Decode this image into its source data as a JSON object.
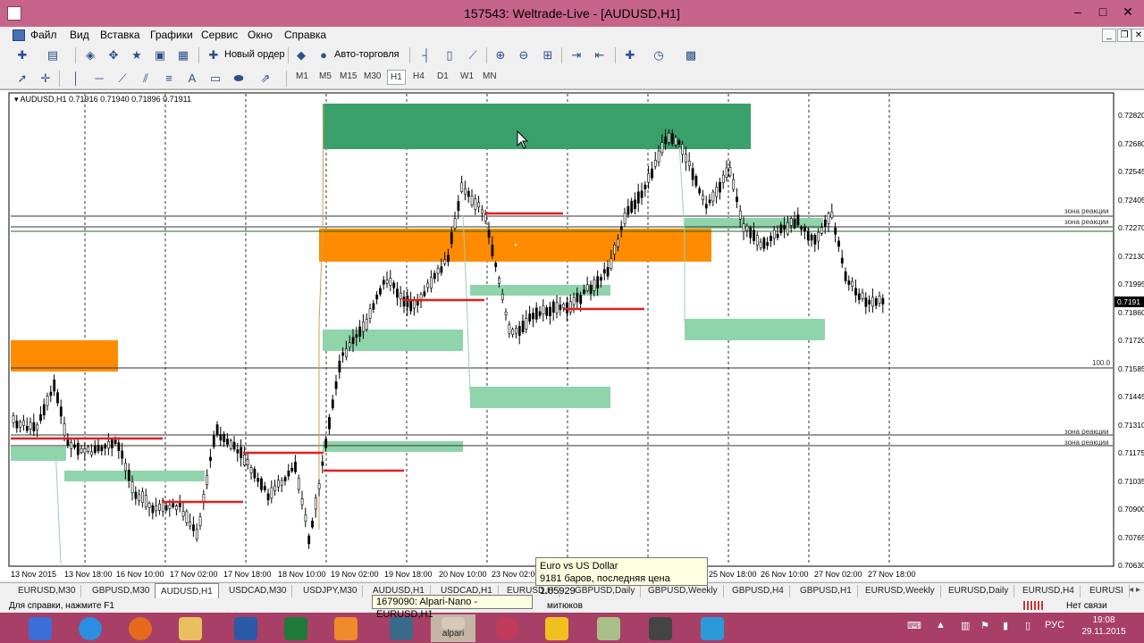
{
  "window": {
    "title": "157543: Weltrade-Live - [AUDUSD,H1]",
    "minimize": "–",
    "maximize": "□",
    "close": "✕"
  },
  "menu": {
    "items": [
      "Файл",
      "Вид",
      "Вставка",
      "Графики",
      "Сервис",
      "Окно",
      "Справка"
    ],
    "mdi_minimize": "_",
    "mdi_restore": "❐",
    "mdi_close": "✕"
  },
  "toolbar": {
    "new_order": "Новый ордер",
    "auto_trading": "Авто-торговля",
    "timeframes": [
      "M1",
      "M5",
      "M15",
      "M30",
      "H1",
      "H4",
      "D1",
      "W1",
      "MN"
    ],
    "active_timeframe": "H1",
    "search_placeholder": ""
  },
  "chart": {
    "header": "AUDUSD,H1  0.71916 0.71940 0.71896 0.71911",
    "symbol": "AUDUSD",
    "timeframe": "H1",
    "ohlc": {
      "open": 0.71916,
      "high": 0.7194,
      "low": 0.71896,
      "close": 0.71911
    },
    "current_price": "0.7191",
    "price_labels": [
      "0.72820",
      "0.72680",
      "0.72545",
      "0.72405",
      "0.72270",
      "0.72130",
      "0.71995",
      "0.71860",
      "0.71720",
      "0.71585",
      "0.71445",
      "0.71310",
      "0.71175",
      "0.71035",
      "0.70900",
      "0.70765",
      "0.70630"
    ],
    "time_labels": [
      "13 Nov 2015",
      "13 Nov 18:00",
      "16 Nov 10:00",
      "17 Nov 02:00",
      "17 Nov 18:00",
      "18 Nov 10:00",
      "19 Nov 02:00",
      "19 Nov 18:00",
      "20 Nov 10:00",
      "23 Nov 02:00",
      "25 Nov 18:00",
      "26 Nov 10:00",
      "27 Nov 02:00",
      "27 Nov 18:00"
    ],
    "zone_label": "зона реакции",
    "level_label": "100.0",
    "colors": {
      "bull_zone_dark": "#3aa06a",
      "bull_zone_light": "#8fd4aa",
      "orange_zone": "#ff8c00",
      "resistance_line": "#e02020",
      "candles": "#000000",
      "grid_dash": "#000000"
    }
  },
  "tooltip": {
    "line1": "Euro vs US Dollar",
    "line2": "9181 баров, последняя цена 1.05929"
  },
  "tooltip2": {
    "text": "1679090: Alpari-Nano - EURUSD,H1"
  },
  "tabs": [
    "EURUSD,M30",
    "GBPUSD,M30",
    "AUDUSD,H1",
    "USDCAD,M30",
    "USDJPY,M30",
    "AUDUSD,H1",
    "USDCAD,H1",
    "EURUSD,H",
    "GBPUSD,Daily",
    "GBPUSD,Weekly",
    "GBPUSD,H4",
    "GBPUSD,H1",
    "EURUSD,Weekly",
    "EURUSD,Daily",
    "EURUSD,H4",
    "EURUSI"
  ],
  "active_tab": "AUDUSD,H1",
  "status": {
    "help": "Для справки, нажмите F1",
    "mid": "митюков",
    "connection": "Нет связи"
  },
  "taskbar": {
    "alpari_label": "alpari",
    "lang": "РУС",
    "time": "19:08",
    "date": "29.11.2015"
  }
}
